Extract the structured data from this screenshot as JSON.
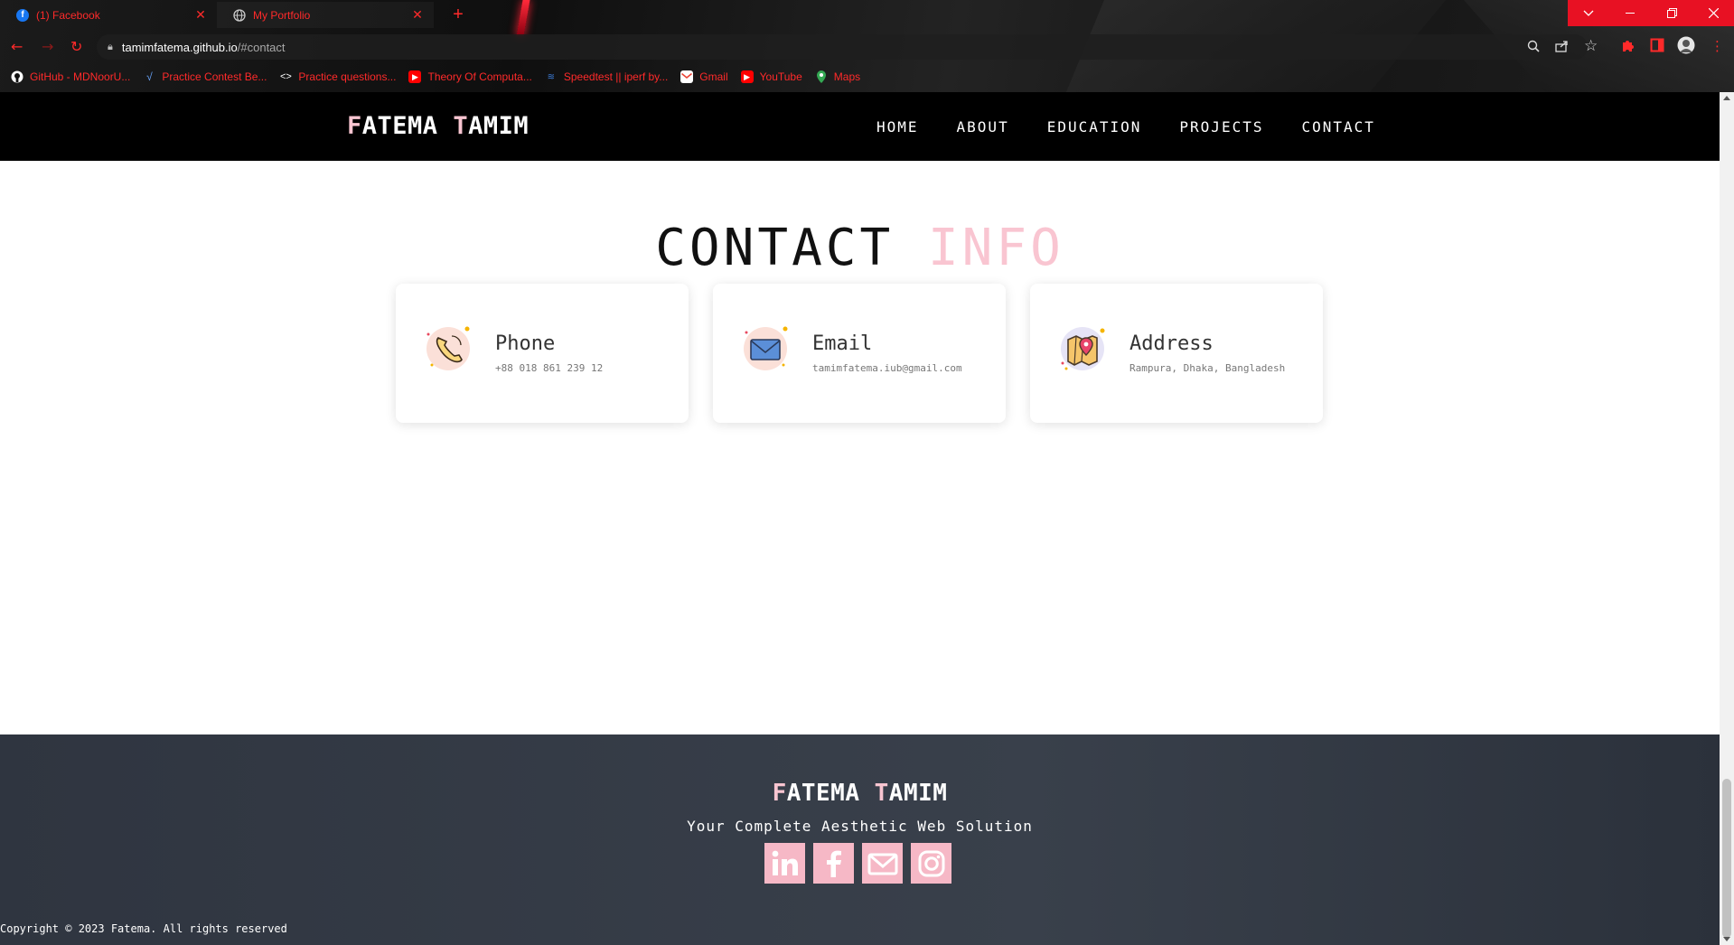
{
  "browser": {
    "tabs": [
      {
        "title": "(1) Facebook",
        "icon": "facebook-icon",
        "active": false
      },
      {
        "title": "My Portfolio",
        "icon": "globe-icon",
        "active": true
      }
    ],
    "new_tab": "+",
    "url_host": "tamimfatema.github.io",
    "url_path": "/#contact",
    "bookmarks": [
      {
        "label": "GitHub - MDNoorU...",
        "icon": "github-icon"
      },
      {
        "label": "Practice Contest Be...",
        "icon": "vjudge-icon"
      },
      {
        "label": "Practice questions...",
        "icon": "code-icon"
      },
      {
        "label": "Theory Of Computa...",
        "icon": "youtube-icon"
      },
      {
        "label": "Speedtest || iperf by...",
        "icon": "speedtest-icon"
      },
      {
        "label": "Gmail",
        "icon": "gmail-icon"
      },
      {
        "label": "YouTube",
        "icon": "youtube-icon"
      },
      {
        "label": "Maps",
        "icon": "maps-icon"
      }
    ],
    "accent_color": "#ff2a2a"
  },
  "navbar": {
    "brand_first_initial": "F",
    "brand_first_rest": "ATEMA ",
    "brand_last_initial": "T",
    "brand_last_rest": "AMIM",
    "links": [
      "HOME",
      "ABOUT",
      "EDUCATION",
      "PROJECTS",
      "CONTACT"
    ]
  },
  "contact": {
    "title_main": "CONTACT",
    "title_accent": "INFO",
    "cards": [
      {
        "label": "Phone",
        "value": "+88 018 861 239 12",
        "icon": "phone-icon"
      },
      {
        "label": "Email",
        "value": "tamimfatema.iub@gmail.com",
        "icon": "envelope-icon"
      },
      {
        "label": "Address",
        "value": "Rampura, Dhaka, Bangladesh",
        "icon": "map-pin-icon"
      }
    ]
  },
  "footer": {
    "brand_first_initial": "F",
    "brand_first_rest": "ATEMA ",
    "brand_last_initial": "T",
    "brand_last_rest": "AMIM",
    "tagline": "Your Complete Aesthetic Web Solution",
    "socials": [
      "linkedin-icon",
      "facebook-icon",
      "gmail-icon",
      "instagram-icon"
    ],
    "copyright": "Copyright © 2023 Fatema. All rights reserved"
  },
  "colors": {
    "accent_pink": "#f9c5d1",
    "navbar_bg": "#000000",
    "footer_bg": "#343a45"
  }
}
